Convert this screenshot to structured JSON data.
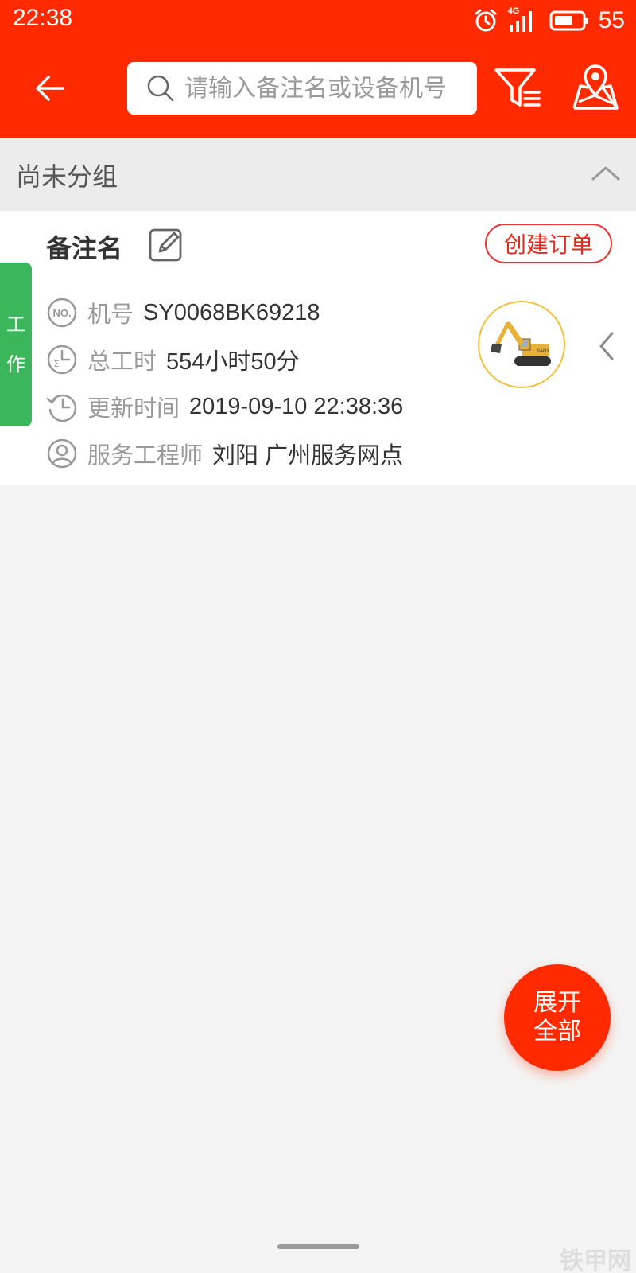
{
  "status_bar": {
    "time": "22:38",
    "network": "4G",
    "battery": "55"
  },
  "toolbar": {
    "search_placeholder": "请输入备注名或设备机号"
  },
  "group": {
    "title": "尚未分组"
  },
  "card": {
    "status_tab": [
      "工",
      "作"
    ],
    "remark_name": "备注名",
    "create_order_label": "创建订单",
    "rows": [
      {
        "icon": "no-icon",
        "label": "机号",
        "value": "SY0068BK69218"
      },
      {
        "icon": "work-hours-clock-icon",
        "label": "总工时",
        "value": "554小时50分"
      },
      {
        "icon": "history-icon",
        "label": "更新时间",
        "value": "2019-09-10 22:38:36"
      },
      {
        "icon": "user-icon",
        "label": "服务工程师",
        "value": "刘阳 广州服务网点"
      }
    ]
  },
  "fab": {
    "line1": "展开",
    "line2": "全部"
  },
  "watermark": "铁甲网",
  "colors": {
    "primary": "#ff2a00",
    "status_green": "#3cb65b",
    "avatar_ring": "#f2c13a"
  }
}
